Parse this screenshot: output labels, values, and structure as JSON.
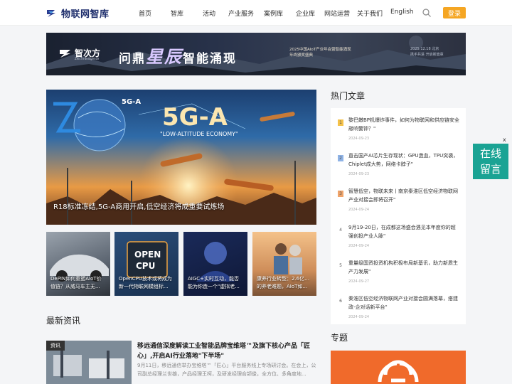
{
  "header": {
    "logo_text": "物联网智库",
    "nav": [
      {
        "label": "首页"
      },
      {
        "label": "智库"
      },
      {
        "label": "活动"
      },
      {
        "label": "产业服务"
      },
      {
        "label": "案例库"
      },
      {
        "label": "企业库"
      },
      {
        "label": "网站运营"
      },
      {
        "label": "关于我们"
      },
      {
        "label": "English"
      }
    ],
    "search_icon": "search-icon",
    "login_label": "登录",
    "accent_color": "#f5a623"
  },
  "banner": {
    "brand": "智次方",
    "brand_sub": "Zhici Intelligence",
    "title_pre": "问鼎",
    "title_star": "星辰",
    "title_post": "智能涌现",
    "sub": "2025中国AIoT产业年会暨智能涌现年终颁奖盛典",
    "right_line1": "2025.12.18 北京",
    "right_line2": "携手共进 开启新篇章"
  },
  "hero": {
    "caption": "R18标准冻结,5G-A商用开启,低空经济将成重要试炼场",
    "badge": "5G-A",
    "headline": "5G-A",
    "sub": "\"LOW-ALTITUDE ECONOMY\""
  },
  "thumbs": [
    {
      "line1": "DePIN如何重塑AIoT价",
      "line2": "值链？从威马车主无..."
    },
    {
      "line1": "OpenCPU技术或将成为",
      "line2": "新一代物联网模组标..."
    },
    {
      "line1": "AIGC+实时互动，能否",
      "line2": "能为你造一个\"虚拟老..."
    },
    {
      "line1": "康养行业转型：2.6亿老人",
      "line2": "的养老难题，AIoT如..."
    }
  ],
  "latest": {
    "title": "最新资讯",
    "item": {
      "tag": "资讯",
      "title": "移远通信深度解读工业智能品牌宝维塔™及旗下核心产品「匠心」,开启AI行业落地\"下半场\"",
      "summary": "9月11日，移远通信举办宝维塔™「匠心」平台服务线上专场研讨会。在会上，公司副总经理兰世雄，产品经理王柯，及研发经理俞颉俊，全方位、多角度地..."
    }
  },
  "hot": {
    "title": "热门文章",
    "items": [
      {
        "num": "1",
        "text": "黎巴嫩BP机爆炸事件，如何为物联网和供应链安全敲响警钟？\"",
        "date": "2024-09-23"
      },
      {
        "num": "2",
        "text": "直击国产AI芯片生存现状：GPU造血，TPU突袭，Chiplet成大势，网络卡脖子\"",
        "date": "2024-09-23"
      },
      {
        "num": "3",
        "text": "智慧低空，物联未来丨南京秦淮区低空经济物联网产业对接会即将召开\"",
        "date": "2024-09-24"
      },
      {
        "num": "4",
        "text": "9月19-20日，在成都这场盛会遇见本年度你的超强创投产业人脉\"",
        "date": "2024-09-24"
      },
      {
        "num": "5",
        "text": "重量级国资投资机构积极布局新基讯，助力新质生产力发展\"",
        "date": "2024-09-27"
      },
      {
        "num": "6",
        "text": "秦淮区低空经济物联网产业对接会圆满落幕，搭建政-企对话新平台\"",
        "date": "2024-09-24"
      }
    ],
    "num_colors": [
      "#f5c24a",
      "#8fb3e6",
      "#f0a46a"
    ]
  },
  "topic": {
    "title": "专题",
    "color": "#f06a2b"
  },
  "float": {
    "close": "x",
    "line1": "在线",
    "line2": "留言",
    "color": "#1aa394"
  }
}
